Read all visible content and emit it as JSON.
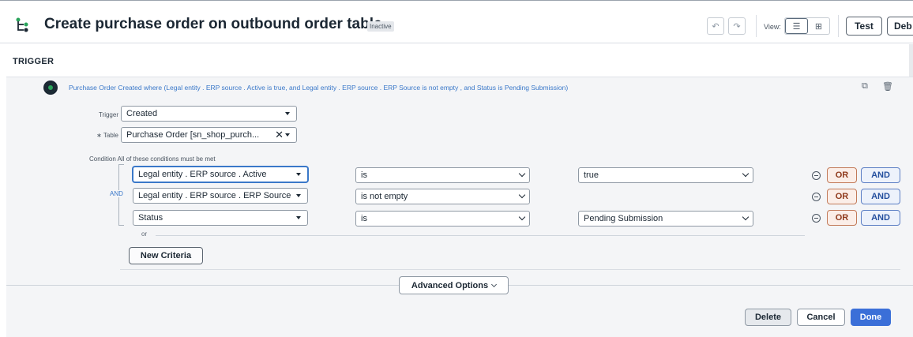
{
  "header": {
    "title": "Create purchase order on outbound order table",
    "status_badge": "Inactive",
    "view_label": "View:",
    "test_label": "Test",
    "debug_label": "Deb",
    "colors": {
      "accent": "#3b6fd8",
      "flow_icon": "#29a35a"
    }
  },
  "trigger": {
    "section_label": "TRIGGER",
    "summary": "Purchase Order Created where (Legal entity . ERP source . Active is true, and Legal entity . ERP source . ERP Source is not empty , and Status is Pending Submission)",
    "trigger_label": "Trigger",
    "trigger_value": "Created",
    "table_label": "Table",
    "required_mark": "∗",
    "table_value": "Purchase Order [sn_shop_purch...",
    "clear_symbol": "✕",
    "condition_label": "Condition",
    "condition_hint": "All of these conditions must be met",
    "and_connector": "AND",
    "conditions": [
      {
        "field": "Legal entity . ERP source . Active",
        "operator": "is",
        "value": "true"
      },
      {
        "field": "Legal entity . ERP source . ERP Source",
        "operator": "is not empty",
        "value": ""
      },
      {
        "field": "Status",
        "operator": "is",
        "value": "Pending Submission"
      }
    ],
    "or_label": "OR",
    "and_label": "AND",
    "or_text": "or",
    "new_criteria_label": "New Criteria",
    "advanced_options_label": "Advanced Options"
  },
  "footer": {
    "delete_label": "Delete",
    "cancel_label": "Cancel",
    "done_label": "Done"
  }
}
